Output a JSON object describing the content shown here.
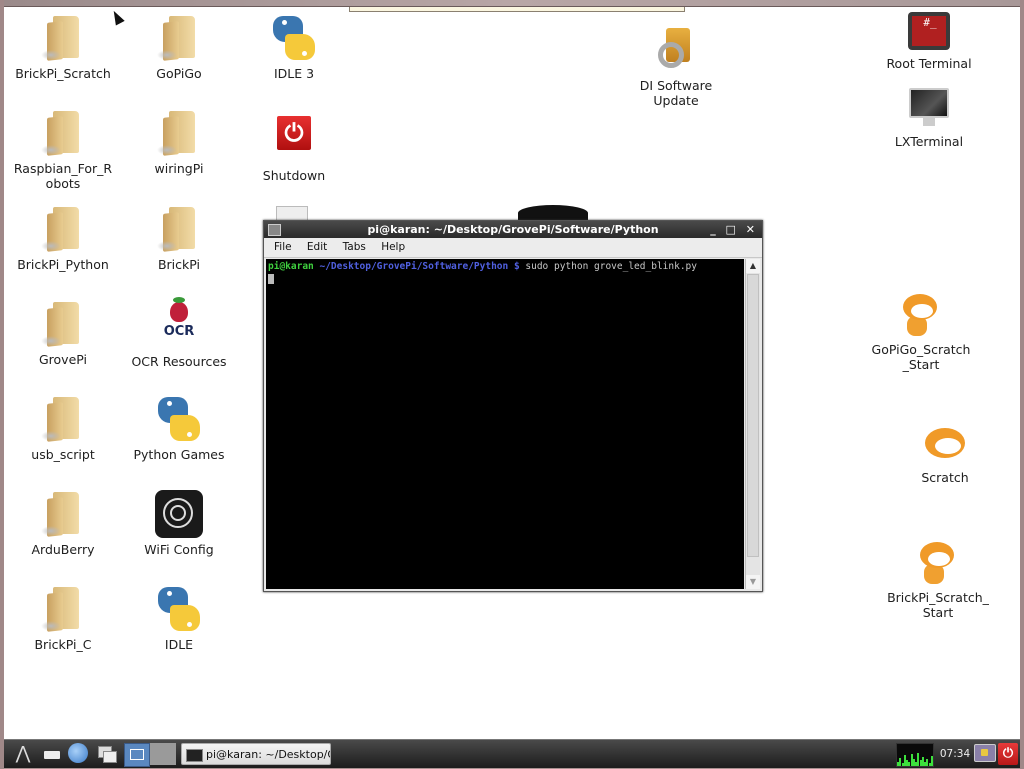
{
  "desktop": {
    "icons": [
      {
        "label": "BrickPi_Scratch",
        "type": "folder"
      },
      {
        "label": "GoPiGo",
        "type": "folder"
      },
      {
        "label": "IDLE 3",
        "type": "python"
      },
      {
        "label": "Raspbian_For_Robots",
        "type": "folder"
      },
      {
        "label": "wiringPi",
        "type": "folder"
      },
      {
        "label": "Shutdown",
        "type": "shutdown"
      },
      {
        "label": "BrickPi_Python",
        "type": "folder"
      },
      {
        "label": "BrickPi",
        "type": "folder"
      },
      {
        "label": "GrovePi",
        "type": "folder"
      },
      {
        "label": "OCR Resources",
        "type": "ocr"
      },
      {
        "label": "usb_script",
        "type": "folder"
      },
      {
        "label": "Python Games",
        "type": "python"
      },
      {
        "label": "ArduBerry",
        "type": "folder"
      },
      {
        "label": "WiFi Config",
        "type": "wifi"
      },
      {
        "label": "BrickPi_C",
        "type": "folder"
      },
      {
        "label": "IDLE",
        "type": "python"
      },
      {
        "label": "DI Software Update",
        "type": "update"
      },
      {
        "label": "Root Terminal",
        "type": "root-terminal"
      },
      {
        "label": "LXTerminal",
        "type": "terminal"
      },
      {
        "label": "GoPiGo_Scratch_Start",
        "type": "scratch"
      },
      {
        "label": "Scratch",
        "type": "scratch"
      },
      {
        "label": "BrickPi_Scratch_Start",
        "type": "scratch"
      }
    ],
    "ocr_logo_text": "OCR",
    "root_terminal_glyph": "#_",
    "shutdown_glyph": "⏻"
  },
  "terminal": {
    "title": "pi@karan: ~/Desktop/GrovePi/Software/Python",
    "controls": {
      "minimize": "_",
      "maximize": "□",
      "close": "✕"
    },
    "menu": [
      "File",
      "Edit",
      "Tabs",
      "Help"
    ],
    "prompt_user": "pi@karan",
    "prompt_path": " ~/Desktop/GrovePi/Software/Python $",
    "command": " sudo python grove_led_blink.py",
    "scroll_up": "▲",
    "scroll_down": "▼"
  },
  "taskbar": {
    "menu_glyph": "⋀",
    "task_label": "pi@karan: ~/Desktop/G...",
    "clock": "07:34",
    "power_glyph": "⏻",
    "cpu_usage_samples": [
      0.2,
      0.35,
      0.15,
      0.5,
      0.25,
      0.2,
      0.55,
      0.3,
      0.2,
      0.6,
      0.25,
      0.4,
      0.2,
      0.3,
      0.15,
      0.45
    ]
  }
}
